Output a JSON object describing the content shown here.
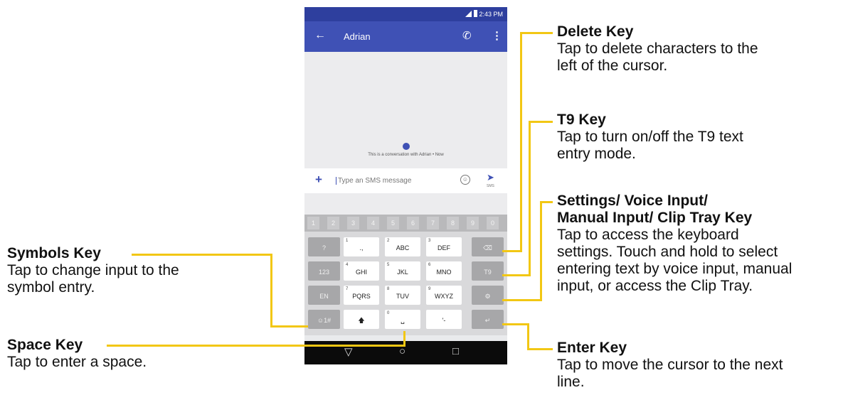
{
  "phone": {
    "status_time": "2:43 PM",
    "contact_name": "Adrian",
    "conversation_note": "This is a conversation with Adrian • Now",
    "compose_placeholder": "Type an SMS message",
    "send_label": "SMS",
    "number_row": [
      "1",
      "2",
      "3",
      "4",
      "5",
      "6",
      "7",
      "8",
      "9",
      "0"
    ],
    "keys": {
      "question": "?",
      "punct": ".,",
      "abc": "ABC",
      "def": "DEF",
      "mode_123": "123",
      "ghi": "GHI",
      "jkl": "JKL",
      "mno": "MNO",
      "t9": "T9",
      "en": "EN",
      "pqrs": "PQRS",
      "tuv": "TUV",
      "wxyz": "WXYZ",
      "symbols": "☺1#",
      "small_punct": "'-",
      "digits": {
        "k1": "1",
        "k2": "2",
        "k3": "3",
        "k4": "4",
        "k5": "5",
        "k6": "6",
        "k7": "7",
        "k8": "8",
        "k9": "9",
        "k0": "0"
      }
    }
  },
  "callouts": {
    "delete": {
      "title": "Delete Key",
      "lines": [
        "Tap to delete characters to the",
        "left of the cursor."
      ]
    },
    "t9": {
      "title": "T9 Key",
      "lines": [
        "Tap to turn on/off the T9 text",
        "entry mode."
      ]
    },
    "settings": {
      "title_lines": [
        "Settings/ Voice Input/",
        "Manual Input/ Clip Tray Key"
      ],
      "lines": [
        "Tap to access the keyboard",
        "settings. Touch and hold to select",
        "entering text by voice input, manual",
        "input, or access the Clip Tray."
      ]
    },
    "enter": {
      "title": "Enter Key",
      "lines": [
        "Tap to move the cursor to the next",
        "line."
      ]
    },
    "symbols": {
      "title": "Symbols Key",
      "lines": [
        "Tap to change input to the",
        "symbol entry."
      ]
    },
    "space": {
      "title": "Space Key",
      "lines": [
        "Tap to enter a space."
      ]
    }
  },
  "colors": {
    "accent": "#3f51b5",
    "status_bar": "#2e3f9e",
    "leader_line": "#f2c714"
  }
}
